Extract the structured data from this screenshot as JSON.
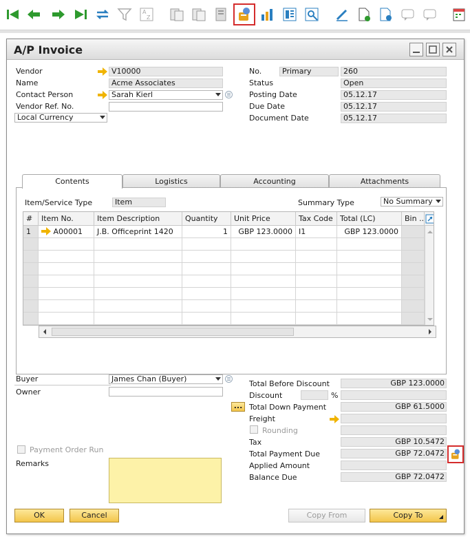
{
  "toolbar": {
    "icons": [
      "first-record-icon",
      "previous-record-icon",
      "next-record-icon",
      "last-record-icon",
      "refresh-icon",
      "filter-icon",
      "sort-icon",
      "base-document-icon",
      "target-document-icon",
      "layout-icon",
      "payment-means-icon",
      "gross-profit-icon",
      "volume-weight-icon",
      "document-settings-icon",
      "edit-icon",
      "new-document-icon",
      "settings-icon",
      "message-icon",
      "message-reply-icon",
      "calendar-icon"
    ]
  },
  "window": {
    "title": "A/P Invoice"
  },
  "header": {
    "vendor_label": "Vendor",
    "vendor_value": "V10000",
    "name_label": "Name",
    "name_value": "Acme Associates",
    "contact_label": "Contact Person",
    "contact_value": "Sarah Kierl",
    "vendor_ref_label": "Vendor Ref. No.",
    "vendor_ref_value": "",
    "currency_value": "Local Currency",
    "no_label": "No.",
    "no_series": "Primary",
    "no_value": "260",
    "status_label": "Status",
    "status_value": "Open",
    "posting_label": "Posting Date",
    "posting_value": "05.12.17",
    "due_label": "Due Date",
    "due_value": "05.12.17",
    "docdate_label": "Document Date",
    "docdate_value": "05.12.17"
  },
  "tabs": [
    {
      "label": "Contents",
      "active": true
    },
    {
      "label": "Logistics",
      "active": false
    },
    {
      "label": "Accounting",
      "active": false
    },
    {
      "label": "Attachments",
      "active": false
    }
  ],
  "contents": {
    "item_type_label": "Item/Service Type",
    "item_type_value": "Item",
    "summary_label": "Summary Type",
    "summary_value": "No Summary",
    "columns": [
      "#",
      "Item No.",
      "Item Description",
      "Quantity",
      "Unit Price",
      "Tax Code",
      "Total (LC)",
      "Bin ..."
    ],
    "rows": [
      {
        "num": "1",
        "item_no": "A00001",
        "description": "J.B. Officeprint 1420",
        "quantity": "1",
        "unit_price": "GBP 123.0000",
        "tax_code": "I1",
        "total": "GBP 123.0000",
        "bin": ""
      }
    ]
  },
  "footer": {
    "buyer_label": "Buyer",
    "buyer_value": "James Chan (Buyer)",
    "owner_label": "Owner",
    "owner_value": "",
    "payment_order_label": "Payment Order Run",
    "remarks_label": "Remarks",
    "remarks_value": ""
  },
  "totals": {
    "before_discount_label": "Total Before Discount",
    "before_discount_value": "GBP 123.0000",
    "discount_label": "Discount",
    "discount_pct": "",
    "discount_pct_sign": "%",
    "discount_value": "",
    "down_payment_btn": "...",
    "down_payment_label": "Total Down Payment",
    "down_payment_value": "GBP 61.5000",
    "freight_label": "Freight",
    "freight_value": "",
    "rounding_label": "Rounding",
    "rounding_value": "",
    "tax_label": "Tax",
    "tax_value": "GBP 10.5472",
    "payment_due_label": "Total Payment Due",
    "payment_due_value": "GBP 72.0472",
    "applied_label": "Applied Amount",
    "applied_value": "",
    "balance_label": "Balance Due",
    "balance_value": "GBP 72.0472"
  },
  "buttons": {
    "ok": "OK",
    "cancel": "Cancel",
    "copy_from": "Copy From",
    "copy_to": "Copy To"
  },
  "colors": {
    "accent_button": "#f3c54b",
    "highlight_border": "#d42b2b",
    "readonly_field": "#e8e8e8",
    "remarks_bg": "#fdf2a8"
  }
}
